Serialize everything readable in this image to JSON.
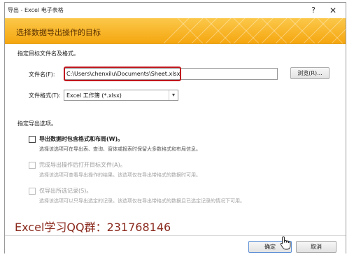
{
  "window": {
    "title": "导出 - Excel 电子表格",
    "help_icon": "?",
    "close_icon": "✕"
  },
  "banner": {
    "title": "选择数据导出操作的目标"
  },
  "destination": {
    "section_label": "指定目标文件名及格式。",
    "filename_label": "文件名(F):",
    "filename_value": "C:\\Users\\chenxilu\\Documents\\Sheet.xlsx",
    "browse_label": "浏览(R)...",
    "format_label": "文件格式(T):",
    "format_value": "Excel 工作簿 (*.xlsx)"
  },
  "options": {
    "section_label": "指定导出选项。",
    "items": [
      {
        "label": "导出数据时包含格式和布局(W)。",
        "desc": "选择该选项可在导出表、查询、窗体或报表时保留大多数格式和布局信息。",
        "checked": false,
        "enabled": true
      },
      {
        "label": "完成导出操作后打开目标文件(A)。",
        "desc": "选择该选项可查看导出操作的结果。该选项仅在导出带格式的数据时可用。",
        "checked": false,
        "enabled": false
      },
      {
        "label": "仅导出所选记录(S)。",
        "desc": "选择该选项可以只导出选定的记录。该选项仅在导出带格式的数据且已选定记录的情况下可用。",
        "checked": false,
        "enabled": false
      }
    ]
  },
  "watermark": "Excel学习QQ群：231768146",
  "footer": {
    "ok_label": "确定",
    "cancel_label": "取消"
  },
  "colors": {
    "banner": "#f5a60f",
    "highlight": "#c0181e",
    "watermark": "#8b2a1e"
  }
}
